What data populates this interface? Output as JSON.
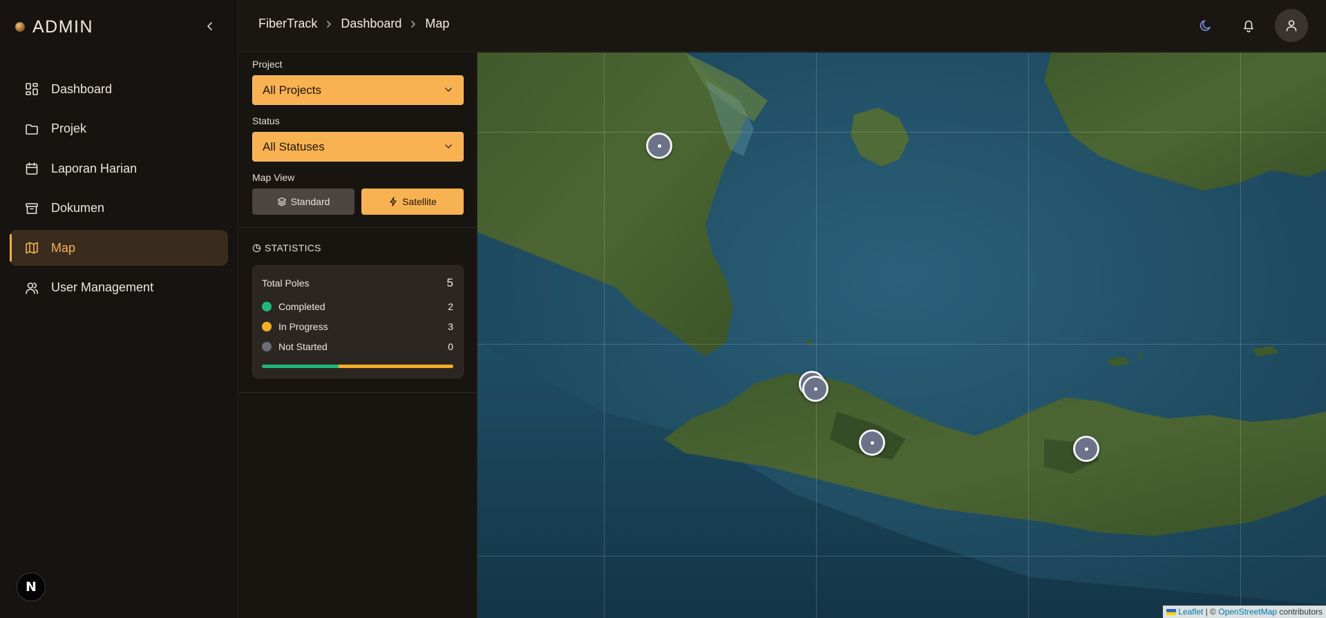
{
  "brand": {
    "name": "ADMIN"
  },
  "sidebar": {
    "items": [
      {
        "label": "Dashboard",
        "icon": "dashboard-icon"
      },
      {
        "label": "Projek",
        "icon": "folder-icon"
      },
      {
        "label": "Laporan Harian",
        "icon": "calendar-icon"
      },
      {
        "label": "Dokumen",
        "icon": "archive-icon"
      },
      {
        "label": "Map",
        "icon": "map-icon",
        "active": true
      },
      {
        "label": "User Management",
        "icon": "users-icon"
      }
    ],
    "footer_logo": "N"
  },
  "breadcrumb": [
    "FiberTrack",
    "Dashboard",
    "Map"
  ],
  "topbar": {
    "icons": [
      "moon-icon",
      "bell-icon",
      "user-icon"
    ]
  },
  "filters": {
    "project_label": "Project",
    "project_value": "All Projects",
    "status_label": "Status",
    "status_value": "All Statuses",
    "map_view_label": "Map View",
    "standard_label": "Standard",
    "satellite_label": "Satellite",
    "selected_view": "Satellite"
  },
  "statistics": {
    "title": "STATISTICS",
    "total_label": "Total Poles",
    "total_value": "5",
    "rows": [
      {
        "label": "Completed",
        "value": "2",
        "color": "#1fb87a"
      },
      {
        "label": "In Progress",
        "value": "3",
        "color": "#f3ae24"
      },
      {
        "label": "Not Started",
        "value": "0",
        "color": "#6b6e78"
      }
    ],
    "progress": {
      "completed_fraction": 0.4,
      "in_progress_fraction": 0.6
    }
  },
  "map": {
    "marker_count": 5,
    "attribution": {
      "leaflet": "Leaflet",
      "sep": "| ©",
      "osm": "OpenStreetMap",
      "suffix": "contributors"
    }
  },
  "colors": {
    "accent": "#f8b251",
    "active_bg": "#3a2c1d",
    "marker": "#6c7389"
  }
}
